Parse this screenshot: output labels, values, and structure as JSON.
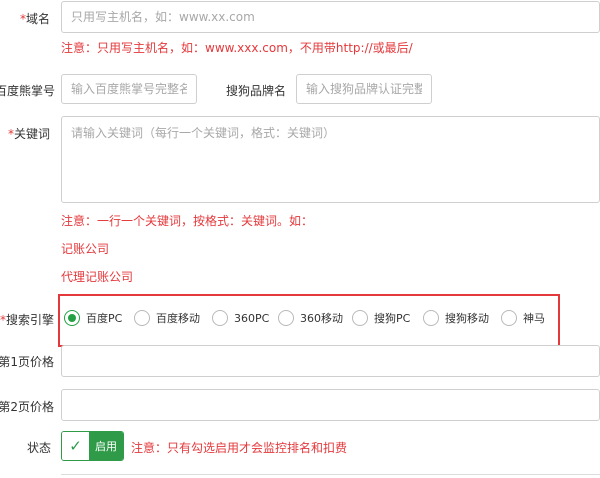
{
  "domain_field": {
    "label": "域名",
    "required_mark": "*",
    "placeholder": "只用写主机名，如：www.xx.com",
    "note": "注意：只用写主机名，如：www.xxx.com，不用带http://或最后/"
  },
  "baidu_account": {
    "label": "百度熊掌号",
    "placeholder": "输入百度熊掌号完整名称"
  },
  "sogou_brand": {
    "label": "搜狗品牌名",
    "placeholder": "输入搜狗品牌认证完整名称"
  },
  "keywords": {
    "label": "关键词",
    "required_mark": "*",
    "placeholder": "请输入关键词（每行一个关键词，格式：关键词）",
    "note": "注意：一行一个关键词，按格式：关键词。如：",
    "examples": [
      "记账公司",
      "代理记账公司"
    ]
  },
  "search_engine": {
    "label": "搜索引擎",
    "required_mark": "*",
    "options": [
      {
        "label": "百度PC",
        "checked": true
      },
      {
        "label": "百度移动",
        "checked": false
      },
      {
        "label": "360PC",
        "checked": false
      },
      {
        "label": "360移动",
        "checked": false
      },
      {
        "label": "搜狗PC",
        "checked": false
      },
      {
        "label": "搜狗移动",
        "checked": false
      },
      {
        "label": "神马",
        "checked": false
      }
    ]
  },
  "page1_price": {
    "label": "第1页价格"
  },
  "page2_price": {
    "label": "第2页价格"
  },
  "status": {
    "label": "状态",
    "toggle_label": "启用",
    "enabled": true,
    "note": "注意：只有勾选启用才会监控排名和扣费"
  },
  "colors": {
    "accent_green": "#2f9b49",
    "error_red": "#e4393c"
  }
}
